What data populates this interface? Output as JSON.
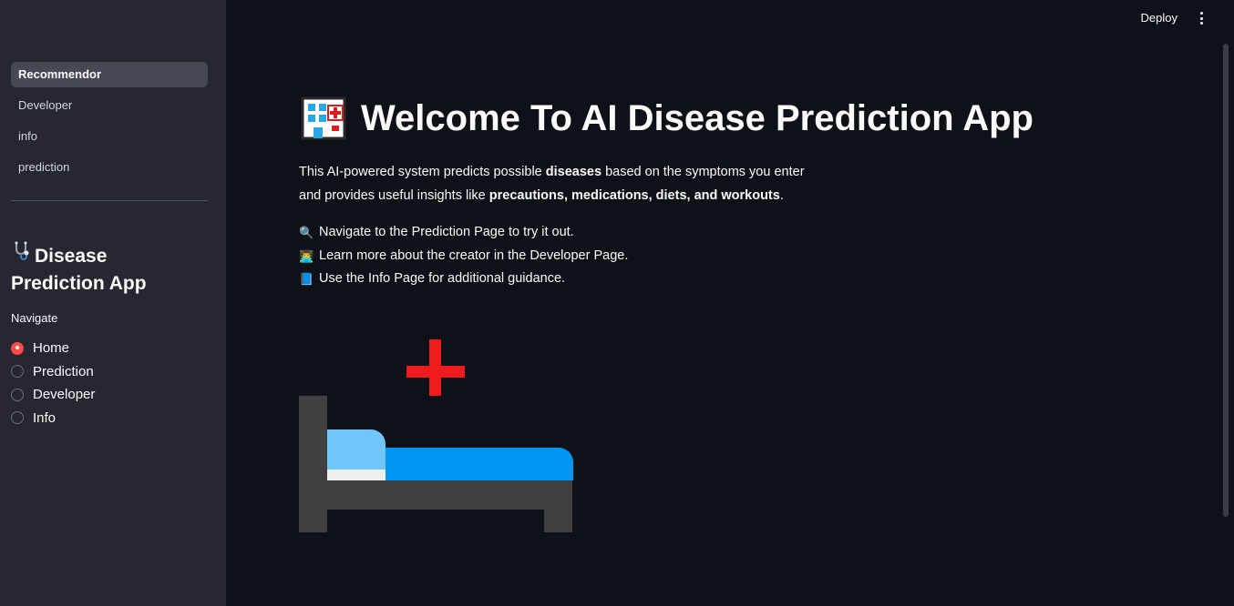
{
  "sidebar": {
    "pages": [
      {
        "label": "Recommendor",
        "active": true
      },
      {
        "label": "Developer",
        "active": false
      },
      {
        "label": "info",
        "active": false
      },
      {
        "label": "prediction",
        "active": false
      }
    ],
    "title_icon": "stethoscope-icon",
    "title_line1": "Disease",
    "title_line2": "Prediction App",
    "radio_label": "Navigate",
    "radio_options": [
      {
        "label": "Home",
        "checked": true
      },
      {
        "label": "Prediction",
        "checked": false
      },
      {
        "label": "Developer",
        "checked": false
      },
      {
        "label": "Info",
        "checked": false
      }
    ]
  },
  "topbar": {
    "deploy_label": "Deploy",
    "menu_icon": "vertical-ellipsis-icon"
  },
  "main": {
    "title_icon": "hospital-icon",
    "title": "Welcome To AI Disease Prediction App",
    "intro": {
      "p1": "This AI-powered system predicts possible ",
      "b1": "diseases",
      "p2": " based on the symptoms you enter",
      "p3": "and provides useful insights like ",
      "b2": "precautions, medications, diets, and workouts",
      "p4": "."
    },
    "lines": [
      {
        "icon": "magnifier-icon",
        "emoji": "🔍",
        "text": "Navigate to the Prediction Page to try it out."
      },
      {
        "icon": "technologist-icon",
        "emoji": "👨‍💻",
        "text": "Learn more about the creator in the Developer Page."
      },
      {
        "icon": "blue-book-icon",
        "emoji": "📘",
        "text": "Use the Info Page for additional guidance."
      }
    ],
    "image_icon": "hospital-bed-icon"
  },
  "colors": {
    "background": "#0e1117",
    "sidebar": "#262730",
    "accent": "#ff4b4b",
    "cross": "#ee1c1c",
    "bed_frame": "#404040",
    "mattress": "#0096f2",
    "pillow": "#6ec6f9"
  }
}
